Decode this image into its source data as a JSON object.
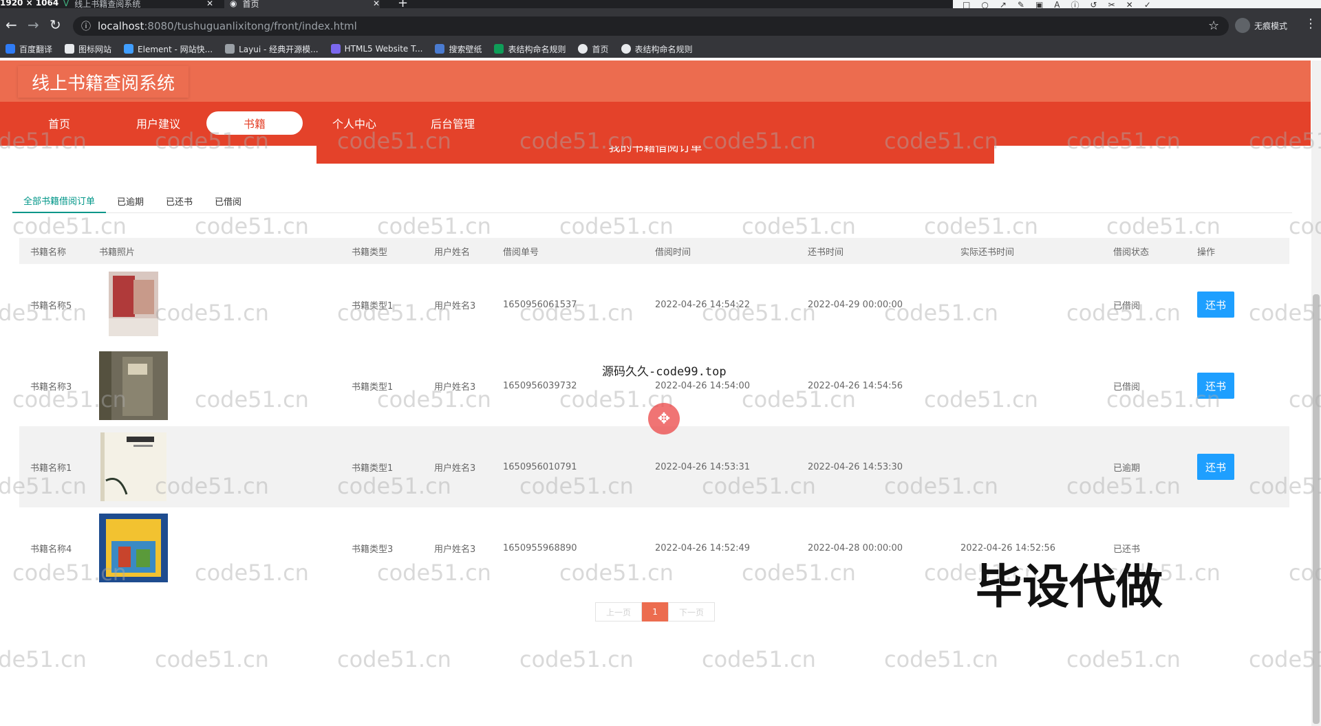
{
  "browser": {
    "resize_label": "1920 × 1064",
    "tabs": [
      {
        "title": "线上书籍查阅系统"
      },
      {
        "title": "首页"
      }
    ],
    "url_host": "localhost",
    "url_path": ":8080/tushuguanlixitong/front/index.html",
    "incognito_label": "无痕模式",
    "bookmarks": [
      "百度翻译",
      "图标网站",
      "Element - 网站快...",
      "Layui - 经典开源模...",
      "HTML5 Website T...",
      "搜索壁纸",
      "表结构命名规则",
      "首页",
      "表结构命名规则"
    ]
  },
  "site": {
    "title": "线上书籍查阅系统",
    "nav": [
      "首页",
      "用户建议",
      "书籍",
      "个人中心",
      "后台管理"
    ],
    "active_nav": "书籍",
    "banner": "我的书籍借阅订单"
  },
  "filter_tabs": [
    "全部书籍借阅订单",
    "已逾期",
    "已还书",
    "已借阅"
  ],
  "table": {
    "headers": [
      "书籍名称",
      "书籍照片",
      "书籍类型",
      "用户姓名",
      "借阅单号",
      "借阅时间",
      "还书时间",
      "实际还书时间",
      "借阅状态",
      "操作"
    ],
    "rows": [
      {
        "name": "书籍名称5",
        "type": "书籍类型1",
        "user": "用户姓名3",
        "no": "1650956061537",
        "borrow": "2022-04-26 14:54:22",
        "return": "2022-04-29 00:00:00",
        "actual": "",
        "status": "已借阅",
        "action": "还书"
      },
      {
        "name": "书籍名称3",
        "type": "书籍类型1",
        "user": "用户姓名3",
        "no": "1650956039732",
        "borrow": "2022-04-26 14:54:00",
        "return": "2022-04-26 14:54:56",
        "actual": "",
        "status": "已借阅",
        "action": "还书"
      },
      {
        "name": "书籍名称1",
        "type": "书籍类型1",
        "user": "用户姓名3",
        "no": "1650956010791",
        "borrow": "2022-04-26 14:53:31",
        "return": "2022-04-26 14:53:30",
        "actual": "",
        "status": "已逾期",
        "action": "还书"
      },
      {
        "name": "书籍名称4",
        "type": "书籍类型3",
        "user": "用户姓名3",
        "no": "1650955968890",
        "borrow": "2022-04-26 14:52:49",
        "return": "2022-04-28 00:00:00",
        "actual": "2022-04-26 14:52:56",
        "status": "已还书",
        "action": ""
      }
    ]
  },
  "pagination": {
    "prev": "上一页",
    "current": "1",
    "next": "下一页"
  },
  "overlays": {
    "watermark": "code51.cn",
    "source_text": "源码久久-code99.top",
    "promo_text": "毕设代做"
  },
  "colors": {
    "header": "#ec6c4f",
    "nav": "#e4422a",
    "tab_active": "#009688",
    "button": "#1e9fff"
  }
}
